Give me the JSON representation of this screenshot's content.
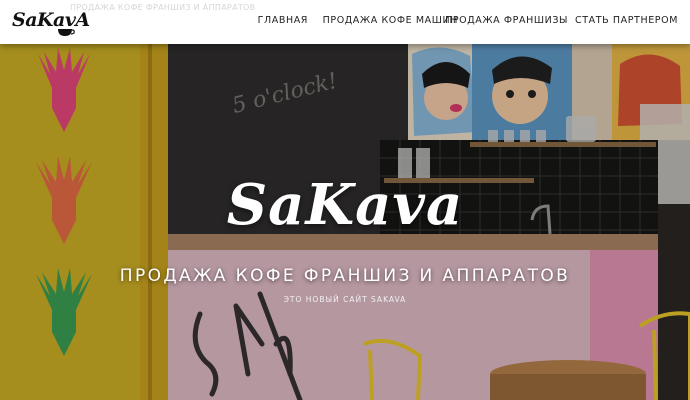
{
  "header": {
    "logo_text": "SaKavA",
    "ghost_text": "ПРОДАЖА КОФЕ ФРАНШИЗ И АППАРАТОВ",
    "nav": [
      {
        "label": "ГЛАВНАЯ"
      },
      {
        "label": "ПРОДАЖА КОФЕ МАШИН"
      },
      {
        "label": "ПРОДАЖА ФРАНШИЗЫ"
      },
      {
        "label": "СТАТЬ ПАРТНЕРОМ"
      }
    ]
  },
  "hero": {
    "chalkboard_text": "5 o'clock!",
    "brand": "SaKava",
    "headline": "ПРОДАЖА КОФЕ ФРАНШИЗ И АППАРАТОВ",
    "subline": "ЭТО НОВЫЙ САЙТ SAKAVA"
  },
  "colors": {
    "yellow_wall": "#e6c42b",
    "deer_pink": "#e5477c",
    "deer_orange": "#e26b45",
    "deer_green": "#3b9d52",
    "nav_text": "#222222",
    "hero_text": "#ffffff"
  }
}
